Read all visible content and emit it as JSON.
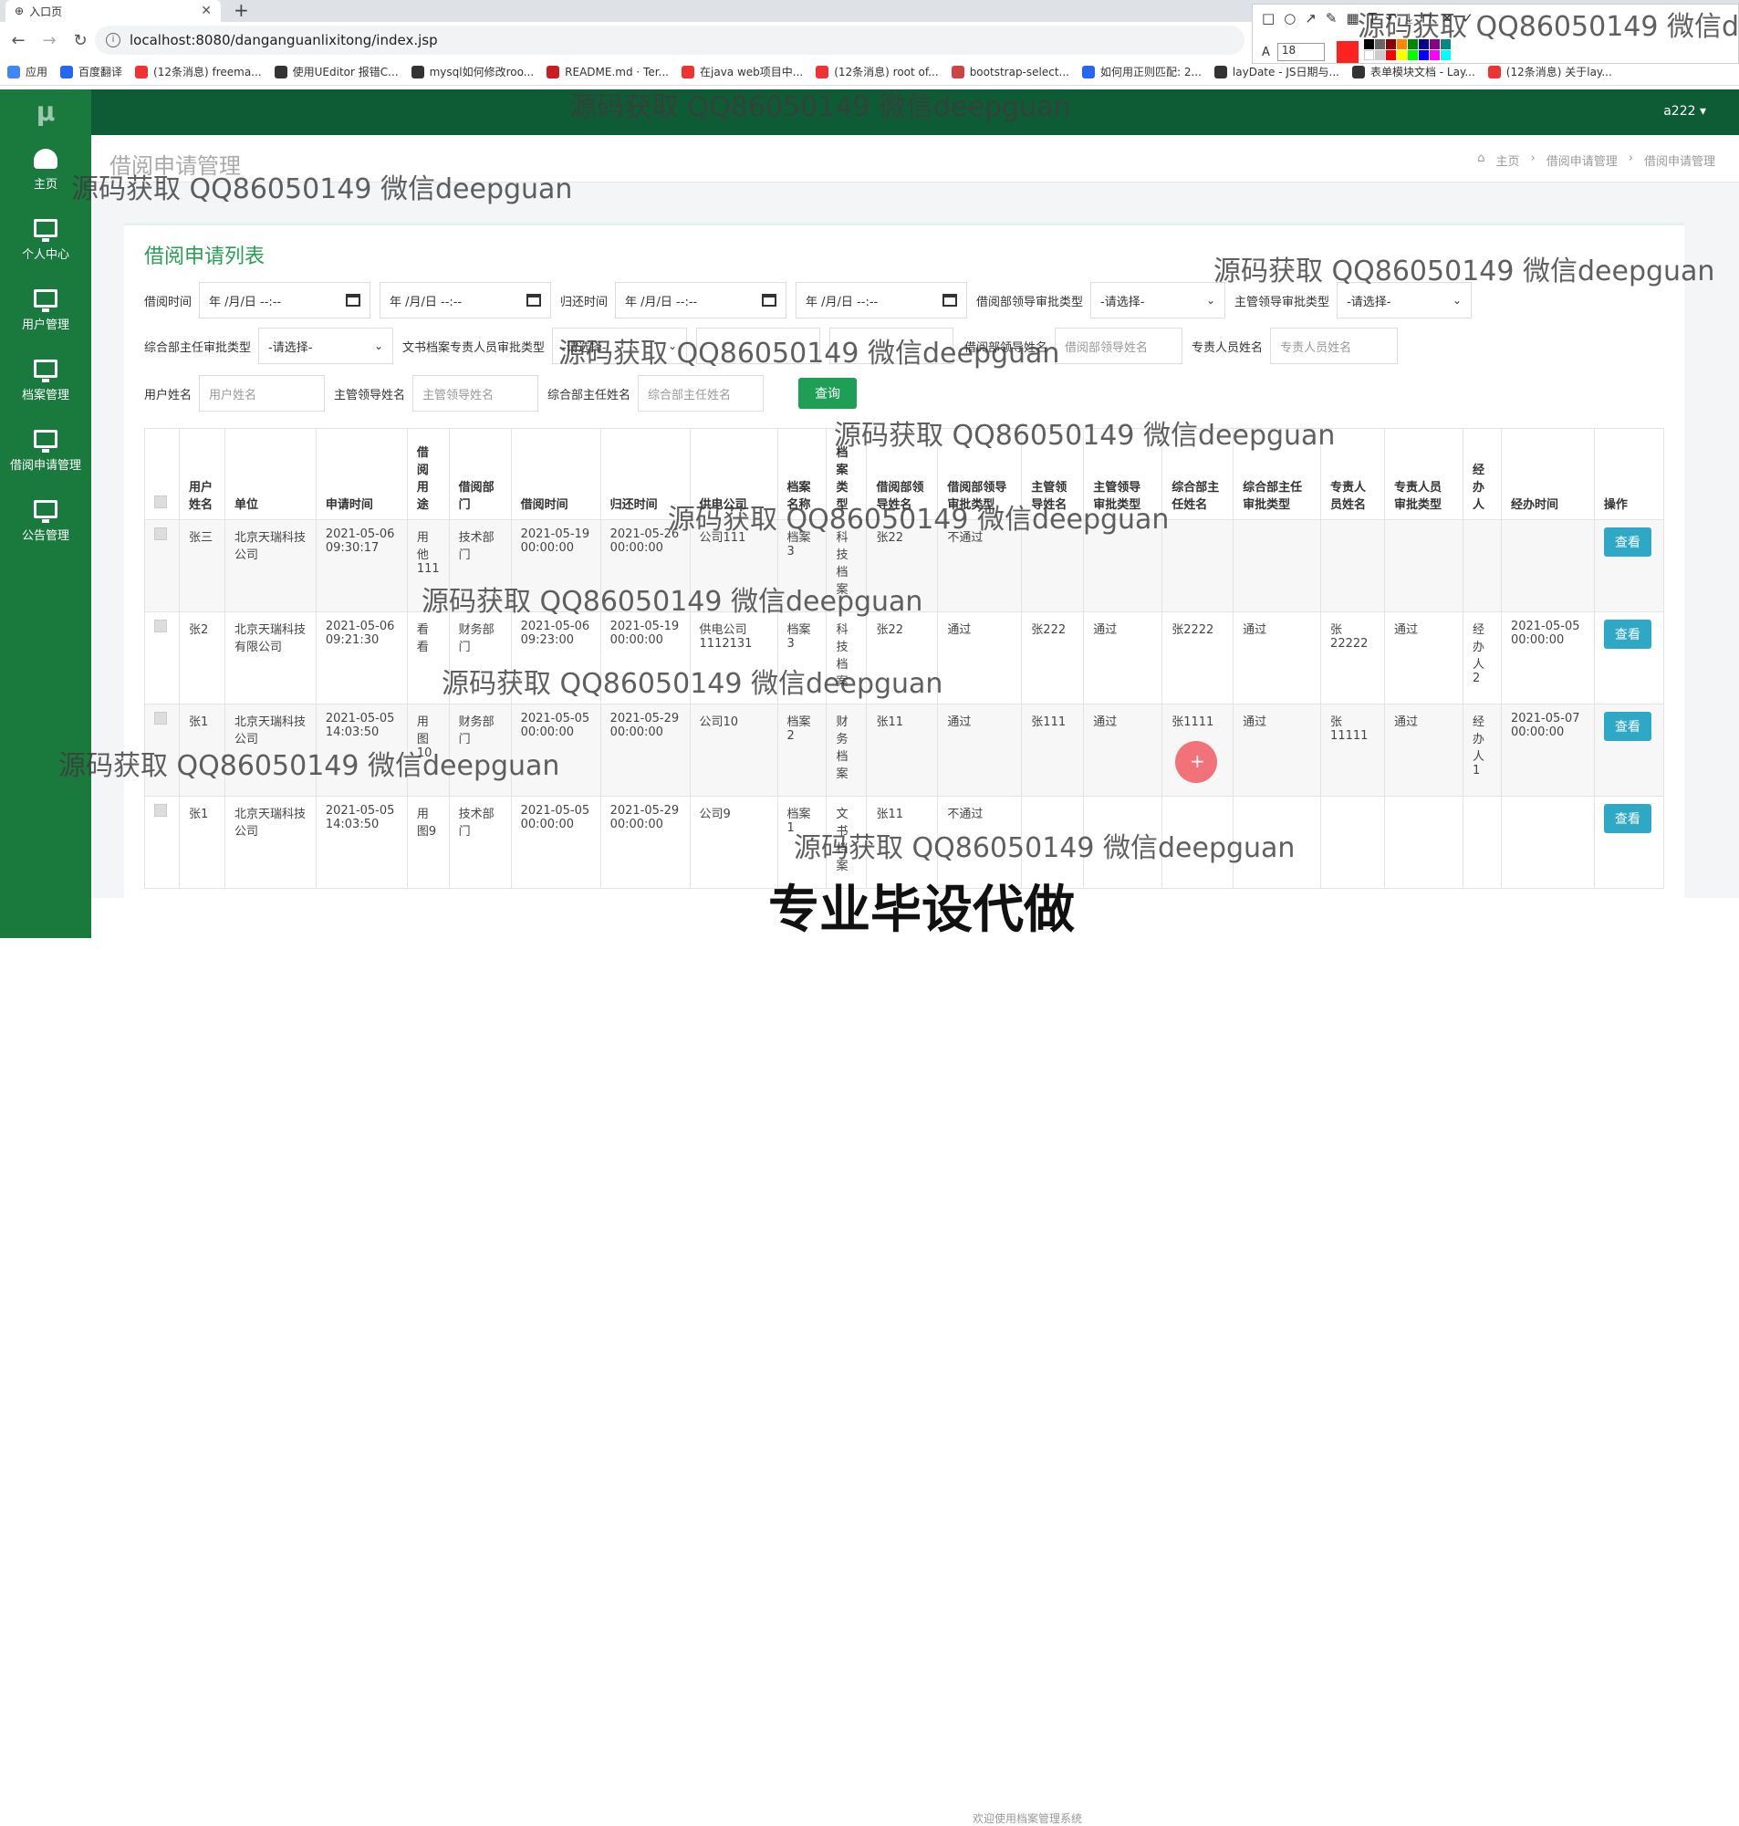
{
  "browser": {
    "tab_title": "入口页",
    "url": "localhost:8080/danganguanlixitong/index.jsp",
    "bookmarks": [
      {
        "label": "应用",
        "color": "#4285f4"
      },
      {
        "label": "百度翻译",
        "color": "#2468f2"
      },
      {
        "label": "(12条消息) freema...",
        "color": "#e33"
      },
      {
        "label": "使用UEditor 报错C...",
        "color": "#333"
      },
      {
        "label": "mysql如何修改roo...",
        "color": "#333"
      },
      {
        "label": "README.md · Ter...",
        "color": "#c71d23"
      },
      {
        "label": "在java web项目中...",
        "color": "#e33"
      },
      {
        "label": "(12条消息) root of...",
        "color": "#e33"
      },
      {
        "label": "bootstrap-select...",
        "color": "#c44"
      },
      {
        "label": "如何用正则匹配: 2...",
        "color": "#2468f2"
      },
      {
        "label": "layDate - JS日期与...",
        "color": "#333"
      },
      {
        "label": "表单模块文档 - Lay...",
        "color": "#333"
      },
      {
        "label": "(12条消息) 关于lay...",
        "color": "#e33"
      }
    ]
  },
  "annotation_tool": {
    "font_size": "18",
    "active_color": "#f22"
  },
  "sidebar": {
    "logo": "μ",
    "items": [
      {
        "label": "主页",
        "icon": "dashboard-icon"
      },
      {
        "label": "个人中心",
        "icon": "monitor-icon"
      },
      {
        "label": "用户管理",
        "icon": "monitor-icon"
      },
      {
        "label": "档案管理",
        "icon": "monitor-icon"
      },
      {
        "label": "借阅申请管理",
        "icon": "monitor-icon"
      },
      {
        "label": "公告管理",
        "icon": "monitor-icon"
      }
    ]
  },
  "header": {
    "user": "a222 ▾"
  },
  "page": {
    "title": "借阅申请管理",
    "breadcrumbs": [
      "主页",
      "借阅申请管理",
      "借阅申请管理"
    ],
    "panel_title": "借阅申请列表"
  },
  "filters": {
    "borrow_time_label": "借阅时间",
    "return_time_label": "归还时间",
    "date_placeholder": "年 /月/日 --:--",
    "dept_leader_type_label": "借阅部领导审批类型",
    "select_placeholder": "-请选择-",
    "main_leader_type_label": "主管领导审批类型",
    "office_head_type_label": "综合部主任审批类型",
    "clerk_type_label": "文书档案专责人员审批类型",
    "dept_leader_name_label": "借阅部领导姓名",
    "dept_leader_name_ph": "借阅部领导姓名",
    "specialist_name_label": "专责人员姓名",
    "specialist_name_ph": "专责人员姓名",
    "user_name_label": "用户姓名",
    "user_name_ph": "用户姓名",
    "main_leader_name_label": "主管领导姓名",
    "main_leader_name_ph": "主管领导姓名",
    "office_head_name_label": "综合部主任姓名",
    "office_head_name_ph": "综合部主任姓名",
    "search_button": "查询"
  },
  "table": {
    "headers": [
      "用户姓名",
      "单位",
      "申请时间",
      "借阅用途",
      "借阅部门",
      "借阅时间",
      "归还时间",
      "供电公司",
      "档案名称",
      "档案类型",
      "借阅部领导姓名",
      "借阅部领导审批类型",
      "主管领导姓名",
      "主管领导审批类型",
      "综合部主任姓名",
      "综合部主任审批类型",
      "专责人员姓名",
      "专责人员审批类型",
      "经办人",
      "经办时间",
      "操作"
    ],
    "rows": [
      [
        "张三",
        "北京天瑞科技公司",
        "2021-05-06 09:30:17",
        "用他111",
        "技术部门",
        "2021-05-19 00:00:00",
        "2021-05-26 00:00:00",
        "公司111",
        "档案3",
        "科技档案",
        "张22",
        "不通过",
        "",
        "",
        "",
        "",
        "",
        "",
        "",
        "",
        "查看"
      ],
      [
        "张2",
        "北京天瑞科技有限公司",
        "2021-05-06 09:21:30",
        "看看",
        "财务部门",
        "2021-05-06 09:23:00",
        "2021-05-19 00:00:00",
        "供电公司1112131",
        "档案3",
        "科技档案",
        "张22",
        "通过",
        "张222",
        "通过",
        "张2222",
        "通过",
        "张22222",
        "通过",
        "经办人2",
        "2021-05-05 00:00:00",
        "查看"
      ],
      [
        "张1",
        "北京天瑞科技公司",
        "2021-05-05 14:03:50",
        "用图10",
        "财务部门",
        "2021-05-05 00:00:00",
        "2021-05-29 00:00:00",
        "公司10",
        "档案2",
        "财务档案",
        "张11",
        "通过",
        "张111",
        "通过",
        "张1111",
        "通过",
        "张11111",
        "通过",
        "经办人1",
        "2021-05-07 00:00:00",
        "查看"
      ],
      [
        "张1",
        "北京天瑞科技公司",
        "2021-05-05 14:03:50",
        "用图9",
        "技术部门",
        "2021-05-05 00:00:00",
        "2021-05-29 00:00:00",
        "公司9",
        "档案1",
        "文书档案",
        "张11",
        "不通过",
        "",
        "",
        "",
        "",
        "",
        "",
        "",
        "",
        "查看"
      ]
    ]
  },
  "watermark_text": "源码获取 QQ86050149 微信deepguan",
  "promo_text": "专业毕设代做",
  "footer_text": "欢迎使用档案管理系统"
}
